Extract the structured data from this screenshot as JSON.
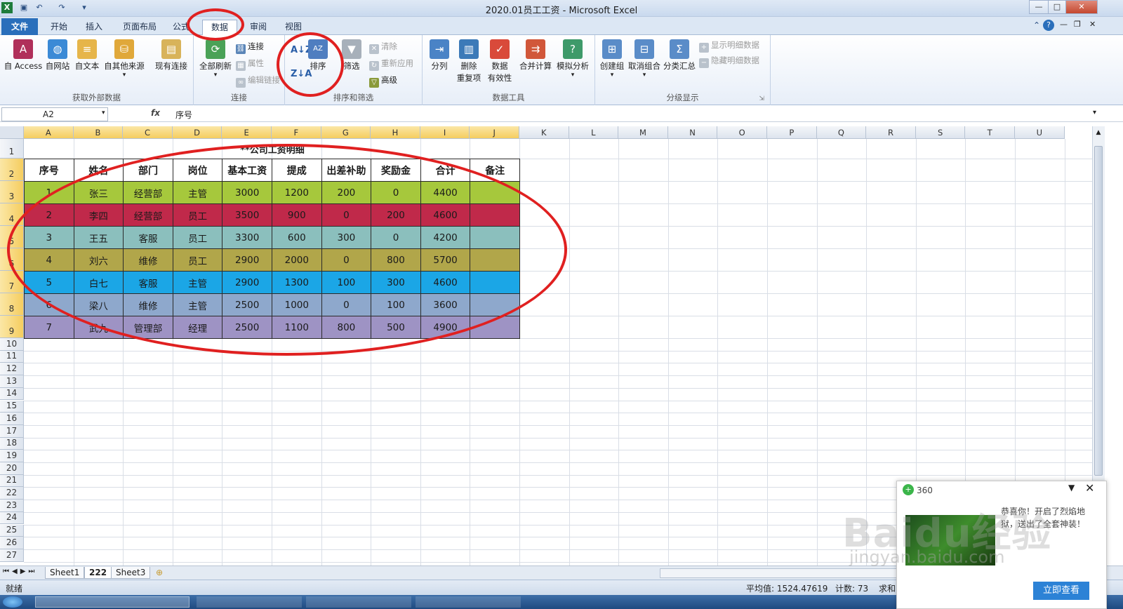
{
  "window": {
    "title": "2020.01员工工资 - Microsoft Excel",
    "app_icon": "excel-logo-icon"
  },
  "quick_access": [
    "save-icon",
    "undo-icon",
    "redo-icon",
    "customize-icon"
  ],
  "tabs": [
    {
      "label": "文件",
      "active": false
    },
    {
      "label": "开始",
      "active": false
    },
    {
      "label": "插入",
      "active": false
    },
    {
      "label": "页面布局",
      "active": false
    },
    {
      "label": "公式",
      "active": false
    },
    {
      "label": "数据",
      "active": true
    },
    {
      "label": "审阅",
      "active": false
    },
    {
      "label": "视图",
      "active": false
    }
  ],
  "ribbon": {
    "groups": [
      {
        "label": "获取外部数据",
        "buttons": [
          "自 Access",
          "自网站",
          "自文本",
          "自其他来源",
          "现有连接"
        ]
      },
      {
        "label": "连接",
        "buttons": [
          "全部刷新",
          "连接",
          "属性",
          "编辑链接"
        ]
      },
      {
        "label": "排序和筛选",
        "buttons": [
          "排序",
          "筛选",
          "清除",
          "重新应用",
          "高级"
        ]
      },
      {
        "label": "数据工具",
        "buttons": [
          "分列",
          "删除重复项",
          "数据有效性",
          "合并计算",
          "模拟分析"
        ]
      },
      {
        "label": "分级显示",
        "buttons": [
          "创建组",
          "取消组合",
          "分类汇总",
          "显示明细数据",
          "隐藏明细数据"
        ]
      }
    ],
    "sort_labels": {
      "az": "A↓Z",
      "za": "Z↓A",
      "sort": "排序"
    },
    "remove_dup": "删除\n重复项",
    "data_valid": "数据\n有效性"
  },
  "formula_bar": {
    "name_box": "A2",
    "fx": "fx",
    "value": "序号"
  },
  "sheet": {
    "columns": [
      "A",
      "B",
      "C",
      "D",
      "E",
      "F",
      "G",
      "H",
      "I",
      "J",
      "K",
      "L",
      "M",
      "N",
      "O",
      "P",
      "Q",
      "R",
      "S",
      "T",
      "U"
    ],
    "rows": [
      "1",
      "2",
      "3",
      "4",
      "5",
      "6",
      "7",
      "8",
      "9",
      "10",
      "11",
      "12",
      "13",
      "14",
      "15",
      "16",
      "17",
      "18",
      "19",
      "20",
      "21",
      "22",
      "23",
      "24",
      "25",
      "26",
      "27"
    ],
    "table_title": "**公司工资明细",
    "headers": [
      "序号",
      "姓名",
      "部门",
      "岗位",
      "基本工资",
      "提成",
      "出差补助",
      "奖励金",
      "合计",
      "备注"
    ],
    "records": [
      [
        "1",
        "张三",
        "经营部",
        "主管",
        "3000",
        "1200",
        "200",
        "0",
        "4400",
        ""
      ],
      [
        "2",
        "李四",
        "经营部",
        "员工",
        "3500",
        "900",
        "0",
        "200",
        "4600",
        ""
      ],
      [
        "3",
        "王五",
        "客服",
        "员工",
        "3300",
        "600",
        "300",
        "0",
        "4200",
        ""
      ],
      [
        "4",
        "刘六",
        "维修",
        "员工",
        "2900",
        "2000",
        "0",
        "800",
        "5700",
        ""
      ],
      [
        "5",
        "白七",
        "客服",
        "主管",
        "2900",
        "1300",
        "100",
        "300",
        "4600",
        ""
      ],
      [
        "6",
        "梁八",
        "维修",
        "主管",
        "2500",
        "1000",
        "0",
        "100",
        "3600",
        ""
      ],
      [
        "7",
        "武九",
        "管理部",
        "经理",
        "2500",
        "1100",
        "800",
        "500",
        "4900",
        ""
      ]
    ],
    "row_colors": [
      "#a6c83c",
      "#c0294a",
      "#8bbfbd",
      "#b1a64a",
      "#1ba6e6",
      "#8ea8cc",
      "#9e93c4"
    ],
    "colors": {
      "selected_header": "#f5cd5f",
      "header_bg": "#dde4ee"
    }
  },
  "sheet_tabs": [
    "Sheet1",
    "222",
    "Sheet3"
  ],
  "status": {
    "mode": "就绪",
    "average": "平均值: 1524.47619",
    "count": "计数: 73",
    "sum": "求和"
  },
  "popup": {
    "brand": "360",
    "message_line1": "恭喜你！开启了烈焰地",
    "message_line2": "狱，送出了全套神装！",
    "button": "立即查看"
  },
  "watermark": {
    "text": "Baidu经验",
    "url": "jingyan.baidu.com"
  }
}
